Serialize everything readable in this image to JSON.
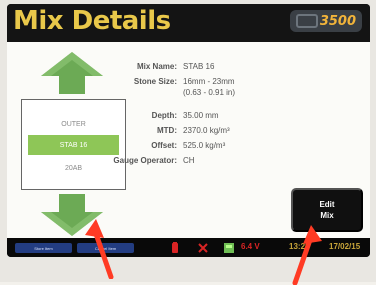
{
  "header": {
    "title": "Mix Details",
    "logo_text": "3500"
  },
  "mix_list": {
    "items": [
      "OUTER",
      "STAB 16",
      "20AB"
    ],
    "selected_index": 1
  },
  "details": [
    {
      "label": "Mix Name:",
      "value": "STAB 16"
    },
    {
      "label": "Stone Size:",
      "value": "16mm - 23mm"
    },
    {
      "label": "",
      "value": "(0.63 - 0.91 in)"
    },
    {
      "label": "Depth:",
      "value": "35.00 mm"
    },
    {
      "label": "MTD:",
      "value": "2370.0 kg/m³"
    },
    {
      "label": "Offset:",
      "value": "525.0 kg/m³"
    },
    {
      "label": "Gauge Operator:",
      "value": "CH"
    }
  ],
  "edit_button": {
    "label_line1": "Edit",
    "label_line2": "Mix"
  },
  "status_bar": {
    "left_button_1": "Store Item",
    "left_button_2": "Cancel Item",
    "battery_voltage": "6.4 V",
    "time": "13:22",
    "date": "17/02/15"
  },
  "colors": {
    "title": "#e9c84a",
    "nav_arrow": "#6caa55",
    "selection": "#8ec657",
    "status_text": "#c9a63a",
    "annotation_arrow": "#ff3b24"
  }
}
